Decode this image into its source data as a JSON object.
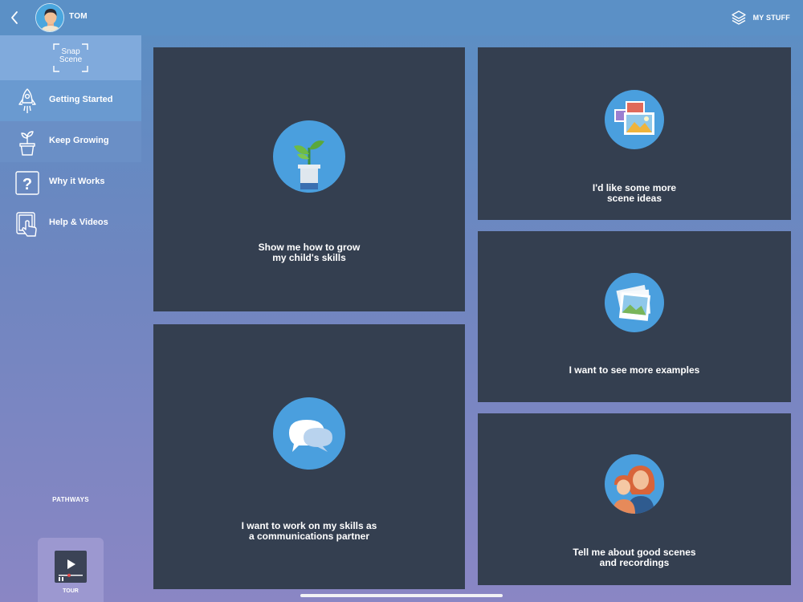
{
  "user": {
    "name": "TOM"
  },
  "header": {
    "my_stuff_label": "MY STUFF"
  },
  "logo": {
    "line1": "Snap",
    "line2": "Scene"
  },
  "sidebar": {
    "items": [
      {
        "label": "Getting Started",
        "icon": "rocket-icon"
      },
      {
        "label": "Keep Growing",
        "icon": "plant-pot-icon"
      },
      {
        "label": "Why it Works",
        "icon": "question-icon"
      },
      {
        "label": "Help & Videos",
        "icon": "tablet-touch-icon"
      }
    ],
    "section_label": "PATHWAYS",
    "tour_label": "TOUR"
  },
  "cards": [
    {
      "label": "Show me how to grow\nmy child's skills",
      "icon": "plant-icon"
    },
    {
      "label": "I'd like some more\nscene ideas",
      "icon": "pictures-icon"
    },
    {
      "label": "I want to see more examples",
      "icon": "photo-stack-icon"
    },
    {
      "label": "I want to work on my skills as\na communications partner",
      "icon": "speech-bubbles-icon"
    },
    {
      "label": "Tell me about good scenes\nand recordings",
      "icon": "parent-child-icon"
    }
  ],
  "colors": {
    "topbar": "#5b90c6",
    "card": "#343f50",
    "icon_circle": "#4a9fde",
    "sidebar_active": "#6a9ad0"
  }
}
